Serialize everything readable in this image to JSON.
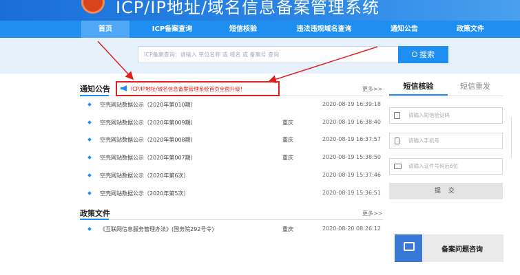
{
  "header": {
    "title": "ICP/IP地址/域名信息备案管理系统",
    "logo_icon": "emblem-icon"
  },
  "nav": {
    "items": [
      {
        "label": "首页",
        "active": true
      },
      {
        "label": "ICP备案查询"
      },
      {
        "label": "短信核验"
      },
      {
        "label": "违法违规域名查询"
      },
      {
        "label": "通知公告"
      },
      {
        "label": "政策文件"
      }
    ]
  },
  "search": {
    "placeholder": "ICP备案查询：请输入 单位名称 或 域名 或 备案号 查询",
    "button_label": "搜索",
    "button_icon": "search-icon"
  },
  "notices": {
    "title": "通知公告",
    "more_label": "更多>>",
    "announcement": "ICP/IP地址/域名信息备案管理系统首页全面升级！",
    "items": [
      {
        "name": "空壳网站数据公示（2020年第010期）",
        "region": "",
        "date": "2020-08-19 16:39:18"
      },
      {
        "name": "空壳网站数据公示（2020年第009期）",
        "region": "重庆",
        "date": "2020-08-19 16:38:40"
      },
      {
        "name": "空壳网站数据公示（2020年第008期）",
        "region": "重庆",
        "date": "2020-08-19 16:37:57"
      },
      {
        "name": "空壳网站数据公示（2020年第007期）",
        "region": "重庆",
        "date": "2020-08-19 15:38:50"
      },
      {
        "name": "空壳网站数据公示（2020年第6次）",
        "region": "",
        "date": "2020-08-19 15:37:46"
      },
      {
        "name": "空壳网站数据公示（2020年第5次）",
        "region": "",
        "date": "2020-08-19 15:36:51"
      }
    ]
  },
  "policy": {
    "title": "政策文件",
    "more_label": "更多>>",
    "items": [
      {
        "name": "《互联网信息服务管理办法》(国务院292号令)",
        "region": "重庆",
        "date": "2020-08-20 08:26:12"
      }
    ]
  },
  "sms": {
    "tabs": [
      "短信核验",
      "短信重发"
    ],
    "fields": [
      {
        "placeholder": "请输入短信验证码",
        "icon": "message-icon"
      },
      {
        "placeholder": "请输入手机号",
        "icon": "phone-icon"
      },
      {
        "placeholder": "请输入证件号码后6位",
        "icon": "id-card-icon"
      }
    ],
    "submit_label": "提 交"
  },
  "consult": {
    "label": "备案问题咨询",
    "icon": "chat-icon"
  },
  "colors": {
    "nav_blue": "#1e8ef0",
    "highlight_red": "#e02020",
    "consult_blue": "#3a78d8"
  }
}
